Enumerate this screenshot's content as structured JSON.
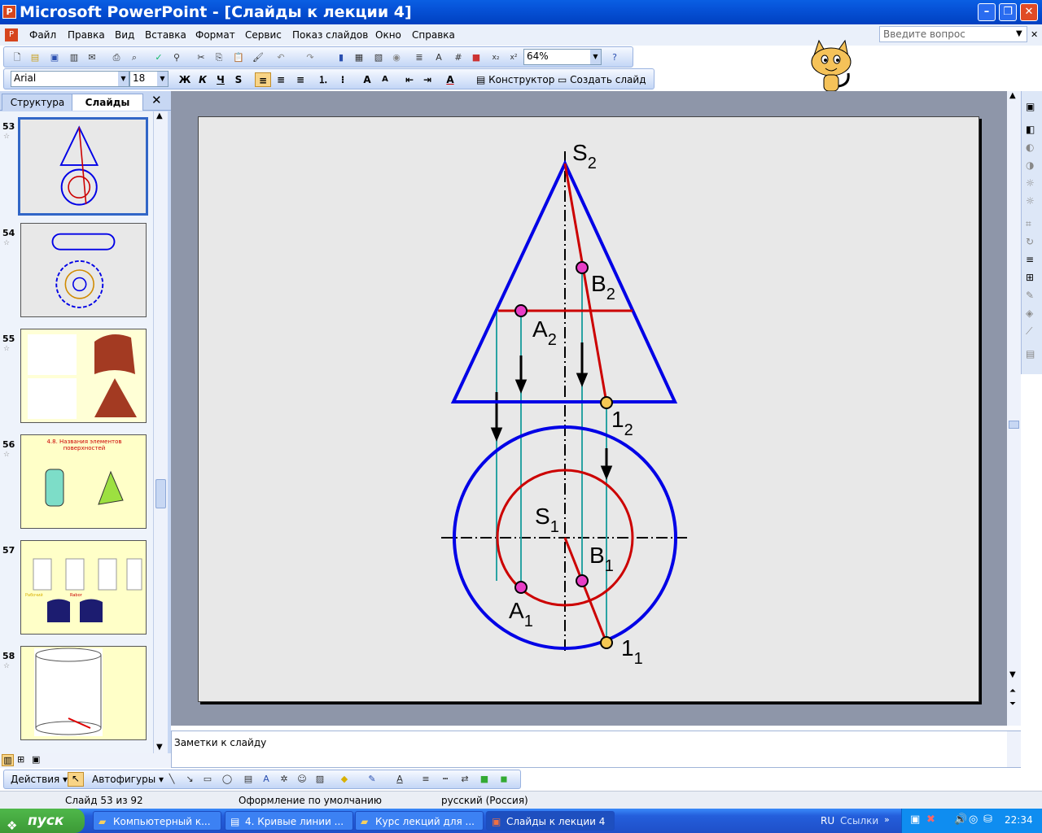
{
  "window": {
    "title": "Microsoft PowerPoint - [Слайды к лекции 4]"
  },
  "menu": [
    "Файл",
    "Правка",
    "Вид",
    "Вставка",
    "Формат",
    "Сервис",
    "Показ слайдов",
    "Окно",
    "Справка"
  ],
  "help_placeholder": "Введите вопрос",
  "toolbar": {
    "zoom": "64%",
    "font": "Arial",
    "font_size": "18",
    "bold": "Ж",
    "italic": "К",
    "underline": "Ч",
    "shadow": "S",
    "designer": "Конструктор",
    "new_slide": "Создать слайд"
  },
  "panel_tabs": {
    "outline": "Структура",
    "slides": "Слайды"
  },
  "thumbnails": [
    {
      "num": "53"
    },
    {
      "num": "54"
    },
    {
      "num": "55"
    },
    {
      "num": "56",
      "caption": "4.8. Названия элементов поверхностей"
    },
    {
      "num": "57",
      "labels": [
        "Рабочий",
        "Rabor"
      ]
    },
    {
      "num": "58"
    }
  ],
  "slide_labels": {
    "S2": "S",
    "S2_sub": "2",
    "B2": "B",
    "B2_sub": "2",
    "A2": "A",
    "A2_sub": "2",
    "P12": "1",
    "P12_sub": "2",
    "S1": "S",
    "S1_sub": "1",
    "B1": "B",
    "B1_sub": "1",
    "A1": "A",
    "A1_sub": "1",
    "P11": "1",
    "P11_sub": "1"
  },
  "notes_placeholder": "Заметки к слайду",
  "drawing_toolbar": {
    "actions": "Действия",
    "autoshapes": "Автофигуры"
  },
  "status": {
    "slide": "Слайд 53 из 92",
    "design": "Оформление по умолчанию",
    "language": "русский (Россия)"
  },
  "taskbar": {
    "start": "пуск",
    "tasks": [
      "Компьютерный к...",
      "4. Кривые линии ...",
      "Курс лекций для ...",
      "Слайды к лекции 4"
    ],
    "lang": "RU",
    "links": "Ссылки",
    "clock": "22:34"
  },
  "colors": {
    "blue_outline": "#0000e6",
    "red_line": "#cc0000",
    "teal_line": "#2aa3a3",
    "magenta_point": "#e83ec6",
    "yellow_point": "#f5c853"
  }
}
